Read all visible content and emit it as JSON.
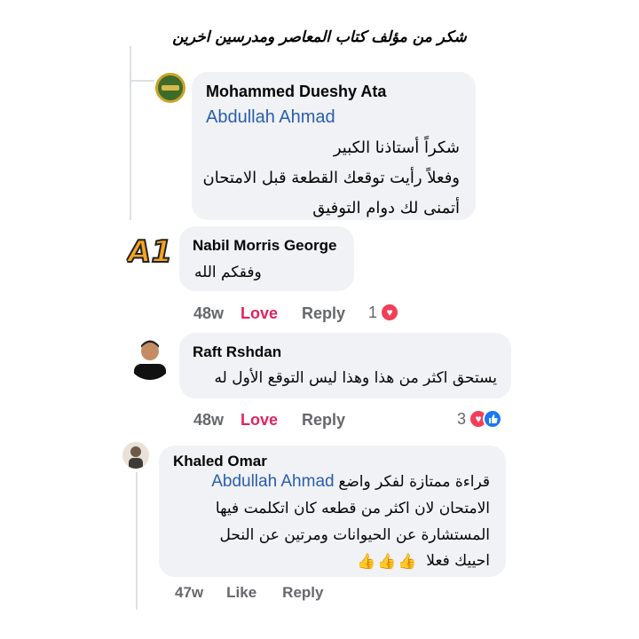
{
  "banner": {
    "title": "شكر من مؤلف كتاب المعاصر ومدرسين اخرين"
  },
  "comments": [
    {
      "author": "Mohammed Dueshy Ata",
      "mention": "Abdullah Ahmad",
      "lines": [
        "شكراً أستاذنا الكبير",
        "وفعلاً رأيت توقعك القطعة قبل الامتحان",
        "أتمنى لك دوام التوفيق"
      ]
    },
    {
      "author": "Nabil Morris George",
      "lines": [
        "وفقكم الله"
      ],
      "avatar_text": "A1",
      "time": "48w",
      "reaction_label": "Love",
      "reply_label": "Reply",
      "reaction_count": "1"
    },
    {
      "author": "Raft Rshdan",
      "lines": [
        "يستحق اكثر من هذا وهذا ليس التوقع الأول له"
      ],
      "time": "48w",
      "reaction_label": "Love",
      "reply_label": "Reply",
      "reaction_count": "3"
    },
    {
      "author": "Khaled Omar",
      "mention": "Abdullah Ahmad",
      "line1_text": "قراءة ممتازة لفكر واضع",
      "lines": [
        "الامتحان لان اكثر من قطعه كان اتكلمت فيها",
        "المستشارة عن الحيوانات ومرتين عن النحل",
        "احييك فعلا"
      ],
      "emoji": [
        "👍",
        "👍",
        "👍"
      ],
      "time": "47w",
      "reaction_label": "Like",
      "reply_label": "Reply"
    }
  ],
  "colors": {
    "bubble": "#f0f2f5",
    "love": "#e0245e",
    "mention": "#2a5db0",
    "meta": "#65676b"
  }
}
